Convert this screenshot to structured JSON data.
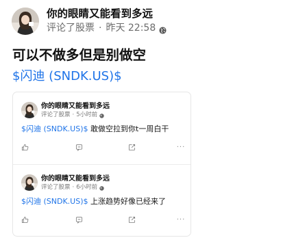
{
  "post": {
    "author": "你的眼睛又能看到多远",
    "action": "评论了股票",
    "separator": "·",
    "time": "昨天 22:58",
    "text": "可以不做多但是别做空",
    "ticker": "$闪迪 (SNDK.US)$",
    "avatar_icon": "user-photo-avatar",
    "visibility_icon": "globe-icon"
  },
  "comments": [
    {
      "author": "你的眼睛又能看到多远",
      "action": "评论了股票",
      "separator": "·",
      "time": "5小时前",
      "ticker": "$闪迪 (SNDK.US)$",
      "text": " 敢做空拉到你t一周白干"
    },
    {
      "author": "你的眼睛又能看到多远",
      "action": "评论了股票",
      "separator": "·",
      "time": "6小时前",
      "ticker": "$闪迪 (SNDK.US)$",
      "text": " 上涨趋势好像已经来了"
    }
  ],
  "actions": {
    "like_icon": "thumbs-up-icon",
    "comment_icon": "comment-icon",
    "share_icon": "share-icon",
    "more_label": "···"
  },
  "colors": {
    "link": "#1f74e8",
    "text": "#111111",
    "muted": "#6b6b6b",
    "border": "#e6e6e6"
  }
}
